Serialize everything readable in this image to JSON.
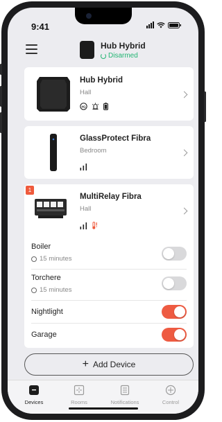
{
  "status_bar": {
    "time": "9:41"
  },
  "header": {
    "hub_name": "Hub Hybrid",
    "hub_state": "Disarmed"
  },
  "devices": [
    {
      "name": "Hub Hybrid",
      "room": "Hall"
    },
    {
      "name": "GlassProtect Fibra",
      "room": "Bedroom"
    },
    {
      "name": "MultiRelay Fibra",
      "room": "Hall",
      "badge": "1"
    }
  ],
  "relays": [
    {
      "name": "Boiler",
      "timer": "15 minutes",
      "state": "off"
    },
    {
      "name": "Torchere",
      "timer": "15 minutes",
      "state": "off"
    },
    {
      "name": "Nightlight",
      "state": "on"
    },
    {
      "name": "Garage",
      "state": "on"
    }
  ],
  "add_device_label": "Add Device",
  "tabs": [
    {
      "label": "Devices",
      "icon": "devices-icon",
      "active": true
    },
    {
      "label": "Rooms",
      "icon": "rooms-icon",
      "active": false
    },
    {
      "label": "Notifications",
      "icon": "notifications-icon",
      "active": false
    },
    {
      "label": "Control",
      "icon": "control-icon",
      "active": false
    }
  ],
  "colors": {
    "accent_on": "#ee5b42",
    "armed_state": "#22b573",
    "badge": "#ef5a3c"
  }
}
